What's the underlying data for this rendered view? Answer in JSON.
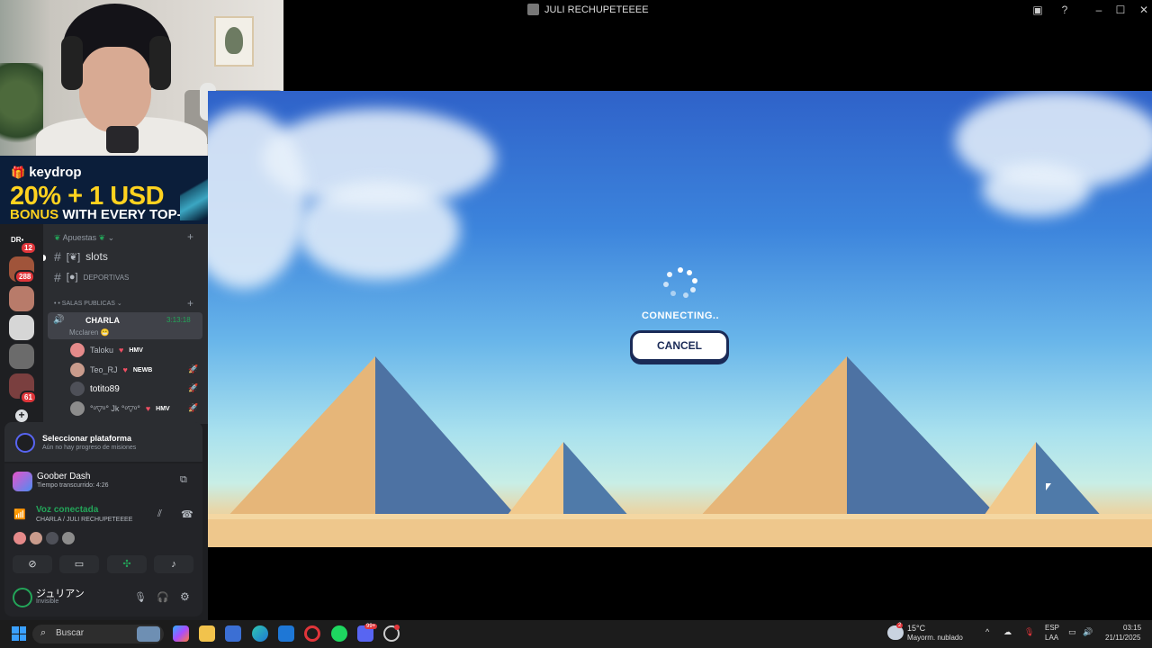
{
  "window": {
    "title": "JULI RECHUPETEEEE"
  },
  "ad": {
    "brand": "keydrop",
    "headline": "20% + 1 USD",
    "sub_bonus": "BONUS",
    "sub_rest": " WITH EVERY TOP-UP"
  },
  "discord": {
    "guild_badges": [
      "12",
      "288",
      "61"
    ],
    "categories": {
      "apuestas": "Apuestas",
      "salas": "• • SALAS PUBLICAS"
    },
    "channels": {
      "slots": "slots",
      "deportivas": "DEPORTIVAS"
    },
    "voice_channel": {
      "name": "CHARLA",
      "timer": "3:13:18",
      "status": "Mcclaren"
    },
    "voice_users": [
      {
        "name": "Taloku",
        "tag": "HMV"
      },
      {
        "name": "Teo_RJ",
        "tag": "NEWB"
      },
      {
        "name": "totito89",
        "tag": ""
      },
      {
        "name": "°ᵒ▽ᵒ° Jk °ᵒ▽ᵒ°",
        "tag": "HMV"
      }
    ],
    "quest": {
      "title": "Seleccionar plataforma",
      "subtitle": "Aún no hay progreso de misiones"
    },
    "activity": {
      "title": "Goober Dash",
      "subtitle": "Tiempo transcurrido: 4:26"
    },
    "voice_connected": {
      "title": "Voz conectada",
      "subtitle": "CHARLA / JULI RECHUPETEEEE"
    },
    "user": {
      "name": "ジュリアン",
      "status": "Invisible"
    }
  },
  "game": {
    "status": "CONNECTING..",
    "cancel_label": "CANCEL"
  },
  "taskbar": {
    "search_placeholder": "Buscar",
    "weather_temp": "15°C",
    "weather_desc": "Mayorm. nublado",
    "weather_badge": "2",
    "lang_top": "ESP",
    "lang_bottom": "LAA",
    "time": "03:15",
    "date": "21/11/2025",
    "discord_badge": "99+"
  },
  "colors": {
    "accent_green": "#23a559",
    "cancel_border": "#1a2a57",
    "badge_red": "#e0353a"
  }
}
